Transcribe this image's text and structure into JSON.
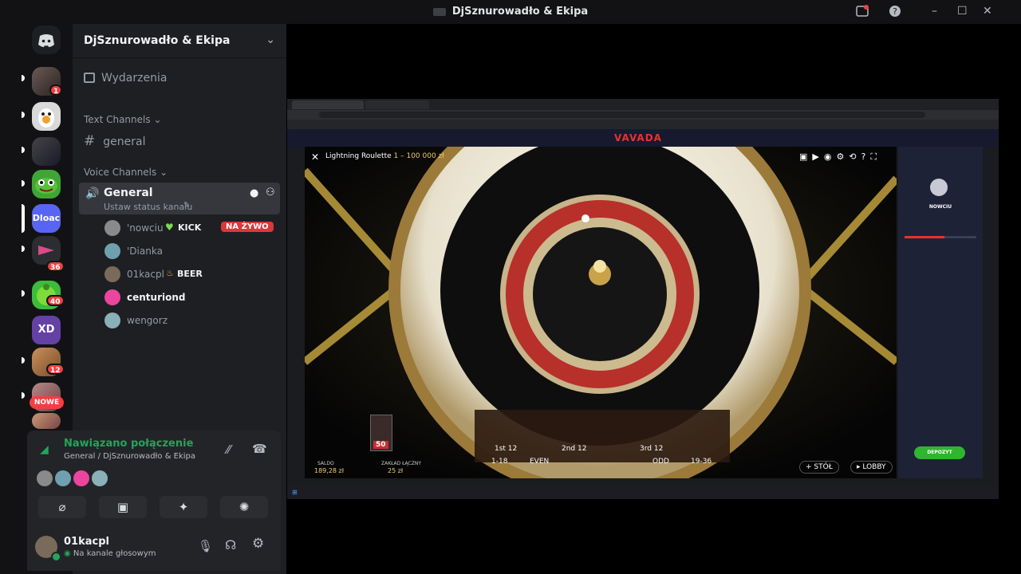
{
  "window": {
    "title": "DjSznurowadło & Ekipa",
    "controls": [
      "–",
      "☐",
      "✕"
    ]
  },
  "servers": {
    "items": [
      {
        "name": "discord-home",
        "badge": ""
      },
      {
        "name": "server-1",
        "badge": "1"
      },
      {
        "name": "server-2",
        "badge": ""
      },
      {
        "name": "server-3",
        "badge": ""
      },
      {
        "name": "server-4",
        "badge": ""
      },
      {
        "name": "Dloac",
        "label": "Dloac",
        "badge": ""
      },
      {
        "name": "server-6",
        "badge": "36"
      },
      {
        "name": "server-7",
        "badge": "40"
      },
      {
        "name": "XD",
        "label": "XD",
        "badge": ""
      },
      {
        "name": "server-9",
        "badge": "12"
      },
      {
        "name": "server-10",
        "badge": ""
      }
    ],
    "nowe_label": "NOWE"
  },
  "sidebar": {
    "server_name": "DjSznurowadło & Ekipa",
    "events": "Wydarzenia",
    "text_category": "Text Channels",
    "text_channel": "general",
    "voice_category": "Voice Channels",
    "voice_channel": "General",
    "voice_status": "Ustaw status kanału",
    "voice_users": [
      {
        "name": "'nowciu",
        "tag": "KICK",
        "badge": "NA ŻYWO",
        "color": "#7ed957"
      },
      {
        "name": "'Dianka",
        "tag": "",
        "badge": ""
      },
      {
        "name": "01kacpl",
        "tag": "BEER",
        "badge": ""
      },
      {
        "name": "centuriond",
        "tag": "",
        "badge": ""
      },
      {
        "name": "wengorz",
        "tag": "",
        "badge": ""
      }
    ]
  },
  "voice_panel": {
    "status": "Nawiązano połączenie",
    "location": "General / DjSznurowadło & Ekipa"
  },
  "user_panel": {
    "username": "01kacpl",
    "status": "Na kanale głosowym"
  },
  "stream": {
    "casino_logo": "VAVADA",
    "game_title": "Lightning Roulette",
    "game_limits": "1 – 100 000 zł",
    "balance_label": "SALDO",
    "balance_value": "189,28 zł",
    "bet_label": "ZAKŁAD ŁĄCZNY",
    "bet_value": "25 zł",
    "table_bets": [
      "1-18",
      "EVEN",
      "ODD",
      "19-36"
    ],
    "dozens": [
      "1st 12",
      "2nd 12",
      "3rd 12"
    ],
    "chip": "50",
    "stol_button": "STÓŁ",
    "lobby_button": "LOBBY",
    "profile_name": "NOWCIU",
    "deposit_button": "DEPOZYT"
  },
  "colors": {
    "accent": "#5865f2",
    "green": "#23a55a",
    "live": "#da373c",
    "bg": "#1e1f22"
  }
}
